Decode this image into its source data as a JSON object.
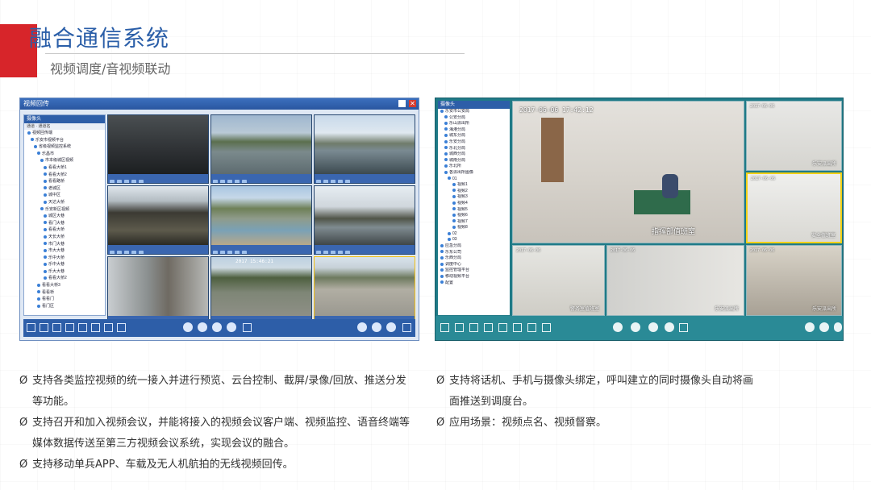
{
  "header": {
    "title": "融合通信系统",
    "subtitle": "视频调度/音视频联动"
  },
  "screen1": {
    "window_title": "视频回传",
    "close_glyph": "✕",
    "tree_title": "摄像头",
    "tree_sub": "通道 · 通道名",
    "tree_items": [
      "视频回传端",
      "乐安市视频平台",
      "省级视频监控系统",
      "乐昌市",
      "市本级城区视频",
      "看看大桥1",
      "看看大桥2",
      "看看路桥",
      "老城区",
      "城中区",
      "天达大桥",
      "乐安新区视频",
      "城区大巷",
      "看门大巷",
      "看看大桥",
      "天长大桥",
      "市门大巷",
      "市大大巷",
      "乐中大桥",
      "乐中大巷",
      "乐大大巷",
      "看看大桥2",
      "看看大桥3",
      "看看桥",
      "看看门",
      "看门区"
    ],
    "tiles": [
      {
        "name": "tile-1",
        "stamp": ""
      },
      {
        "name": "tile-2",
        "stamp": ""
      },
      {
        "name": "tile-3",
        "stamp": ""
      },
      {
        "name": "tile-4",
        "stamp": ""
      },
      {
        "name": "tile-5",
        "stamp": ""
      },
      {
        "name": "tile-6",
        "stamp": ""
      },
      {
        "name": "tile-7",
        "stamp": ""
      },
      {
        "name": "tile-8",
        "stamp": "2017  15:46:21"
      },
      {
        "name": "tile-9",
        "stamp": ""
      }
    ]
  },
  "screen2": {
    "tree_title": "摄像头",
    "tree_items": [
      "乐安市公安局",
      "公安分局",
      "乐山派出所",
      "海港分局",
      "城东分局",
      "乐安分局",
      "乐北分局",
      "城西分局",
      "城南分局",
      "乐北所",
      "各派出所图像",
      "01",
      "视频1",
      "视频2",
      "视频3",
      "视频4",
      "视频5",
      "视频6",
      "视频7",
      "视频8",
      "02",
      "03",
      "应急分局",
      "乐东公司",
      "乐西分局",
      "调度中心",
      "监控管理平台",
      "移动视频平台",
      "配置"
    ],
    "main_timestamp": "2017-06-06 17:42:12",
    "main_caption": "指挥部值班室",
    "small_timestamps": [
      "2017-06-06",
      "2017-06-06",
      "2017-06-06",
      "2017-06-06",
      "2017-06-06"
    ],
    "small_captions": [
      "乐安派出所",
      "安全值班室",
      "警务室值班室",
      "乐安派出所",
      "乐安派出所"
    ]
  },
  "bullets_left": [
    {
      "marker": "Ø",
      "text": "支持各类监控视频的统一接入并进行预览、云台控制、截屏/录像/回放、推送分发等功能。"
    },
    {
      "marker": "Ø",
      "text": "支持召开和加入视频会议，并能将接入的视频会议客户端、视频监控、语音终端等媒体数据传送至第三方视频会议系统，实现会议的融合。"
    },
    {
      "marker": "Ø",
      "text": "支持移动单兵APP、车载及无人机航拍的无线视频回传。"
    }
  ],
  "bullets_right": [
    {
      "marker": "Ø",
      "text": "支持将话机、手机与摄像头绑定，呼叫建立的同时摄像头自动将画面推送到调度台。"
    },
    {
      "marker": "Ø",
      "text": "应用场景：视频点名、视频督察。"
    }
  ],
  "colors": {
    "accent_red": "#d7252a",
    "title_blue": "#2a5ea8",
    "toolbar_blue": "#2d5ea8",
    "teal": "#1f7a87"
  }
}
